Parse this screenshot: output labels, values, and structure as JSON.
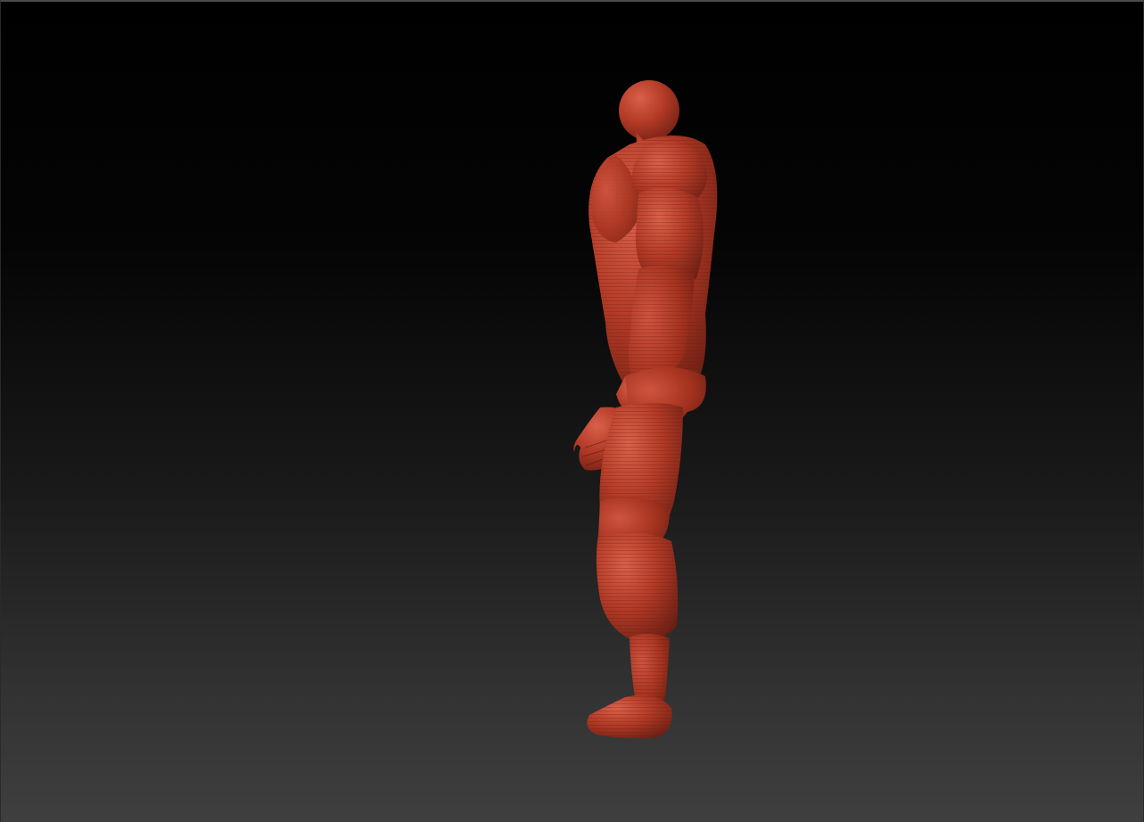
{
  "canvas": {
    "background_top_color": "#000000",
    "background_bottom_color": "#3f3f3f"
  },
  "model": {
    "name": "human-figure-sculpt",
    "view": "side profile",
    "material_color": "#b23a26",
    "highlight_color": "#d9614a",
    "shadow_color": "#5e1a10"
  }
}
